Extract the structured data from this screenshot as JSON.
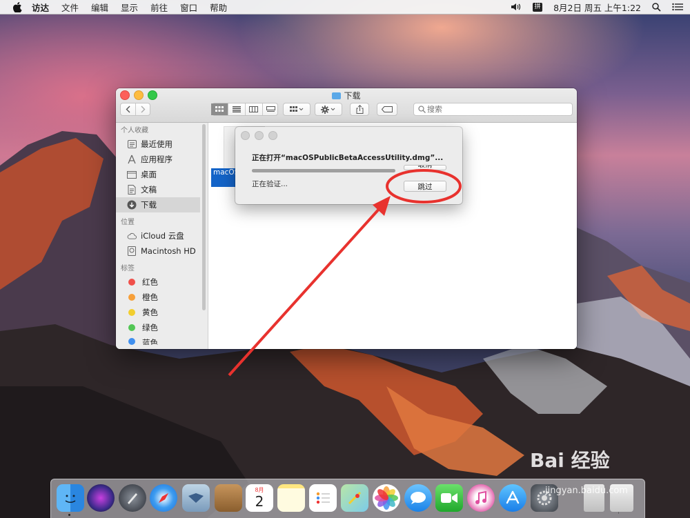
{
  "menubar": {
    "items": [
      "访达",
      "文件",
      "编辑",
      "显示",
      "前往",
      "窗口",
      "帮助"
    ],
    "clock": "8月2日 周五 上午1:22",
    "input_method": "拼"
  },
  "finder": {
    "title": "下载",
    "search_placeholder": "搜索",
    "sidebar": {
      "favorites_header": "个人收藏",
      "favorites": [
        "最近使用",
        "应用程序",
        "桌面",
        "文稿",
        "下载"
      ],
      "locations_header": "位置",
      "locations": [
        "iCloud 云盘",
        "Macintosh HD"
      ],
      "tags_header": "标签",
      "tags": [
        {
          "label": "红色",
          "color": "#f0504a"
        },
        {
          "label": "橙色",
          "color": "#f7a03a"
        },
        {
          "label": "黄色",
          "color": "#f2ce2f"
        },
        {
          "label": "绿色",
          "color": "#52c655"
        },
        {
          "label": "蓝色",
          "color": "#3f8fef"
        }
      ]
    },
    "file_label": "macOSPublicBetaAccessUtility.dmg"
  },
  "dialog": {
    "message": "正在打开“macOSPublicBetaAccessUtility.dmg”...",
    "status": "正在验证...",
    "progress": 1.0,
    "cancel_label": "取消",
    "skip_label": "跳过"
  },
  "dock": {
    "apps": [
      "finder-icon",
      "siri-icon",
      "launchpad-icon",
      "safari-icon",
      "mail-icon",
      "contacts-icon",
      "calendar-icon",
      "notes-icon",
      "reminders-icon",
      "maps-icon",
      "photos-icon",
      "messages-icon",
      "facetime-icon",
      "itunes-icon",
      "app-store-icon",
      "system-preferences-icon",
      "downloads-stack-icon",
      "trash-icon"
    ],
    "calendar_month": "8月",
    "calendar_day": "2"
  },
  "watermark": {
    "brand": "Bai 经验",
    "url": "jingyan.baidu.com"
  },
  "annotation_color": "#e8322e"
}
